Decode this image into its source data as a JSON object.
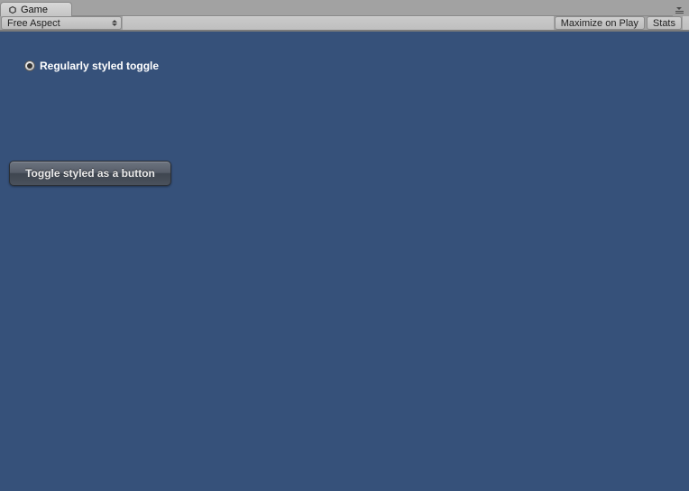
{
  "tab": {
    "label": "Game"
  },
  "toolbar": {
    "aspect_dropdown": "Free Aspect",
    "maximize_label": "Maximize on Play",
    "stats_label": "Stats"
  },
  "viewport": {
    "toggle_label": "Regularly styled toggle",
    "button_toggle_label": "Toggle styled as a button"
  },
  "colors": {
    "viewport_bg": "#36517a"
  }
}
